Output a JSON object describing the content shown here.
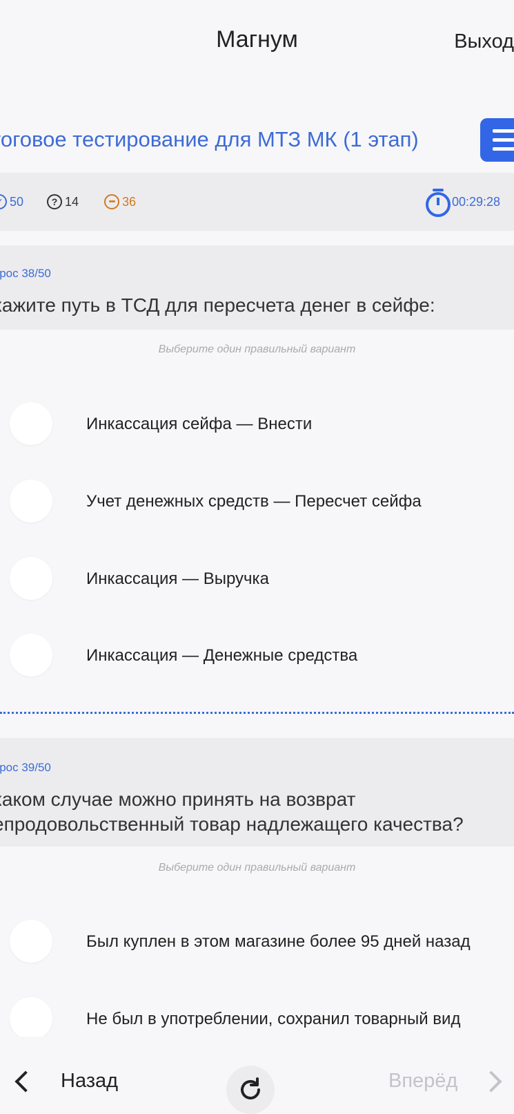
{
  "header": {
    "title": "Магнум",
    "logout_label": "Выход"
  },
  "test": {
    "title": "тоговое тестирование для МТЗ МК (1 этап)"
  },
  "stats": {
    "total": "50",
    "unanswered": "14",
    "remaining": "36",
    "timer": "00:29:28"
  },
  "questions": [
    {
      "number": "прос 38/50",
      "text_lines": [
        "кажите путь в ТСД для пересчета денег в сейфе:"
      ],
      "hint": "Выберите один правильный вариант",
      "options": [
        "Инкассация сейфа — Внести",
        "Учет денежных средств — Пересчет сейфа",
        "Инкассация — Выручка",
        "Инкассация — Денежные средства"
      ]
    },
    {
      "number": "прос 39/50",
      "text_lines": [
        "каком случае можно принять на возврат",
        "епродовольственный товар надлежащего качества?"
      ],
      "hint": "Выберите один правильный вариант",
      "options": [
        "Был куплен в этом магазине более 95 дней назад",
        "Не был в употреблении, сохранил товарный вид"
      ]
    }
  ],
  "nav": {
    "back_label": "Назад",
    "next_label": "Вперёд"
  },
  "colors": {
    "accent": "#3366e6",
    "link": "#3d6bd6",
    "orange": "#d27a1e",
    "disabled": "#c4c4c8"
  }
}
